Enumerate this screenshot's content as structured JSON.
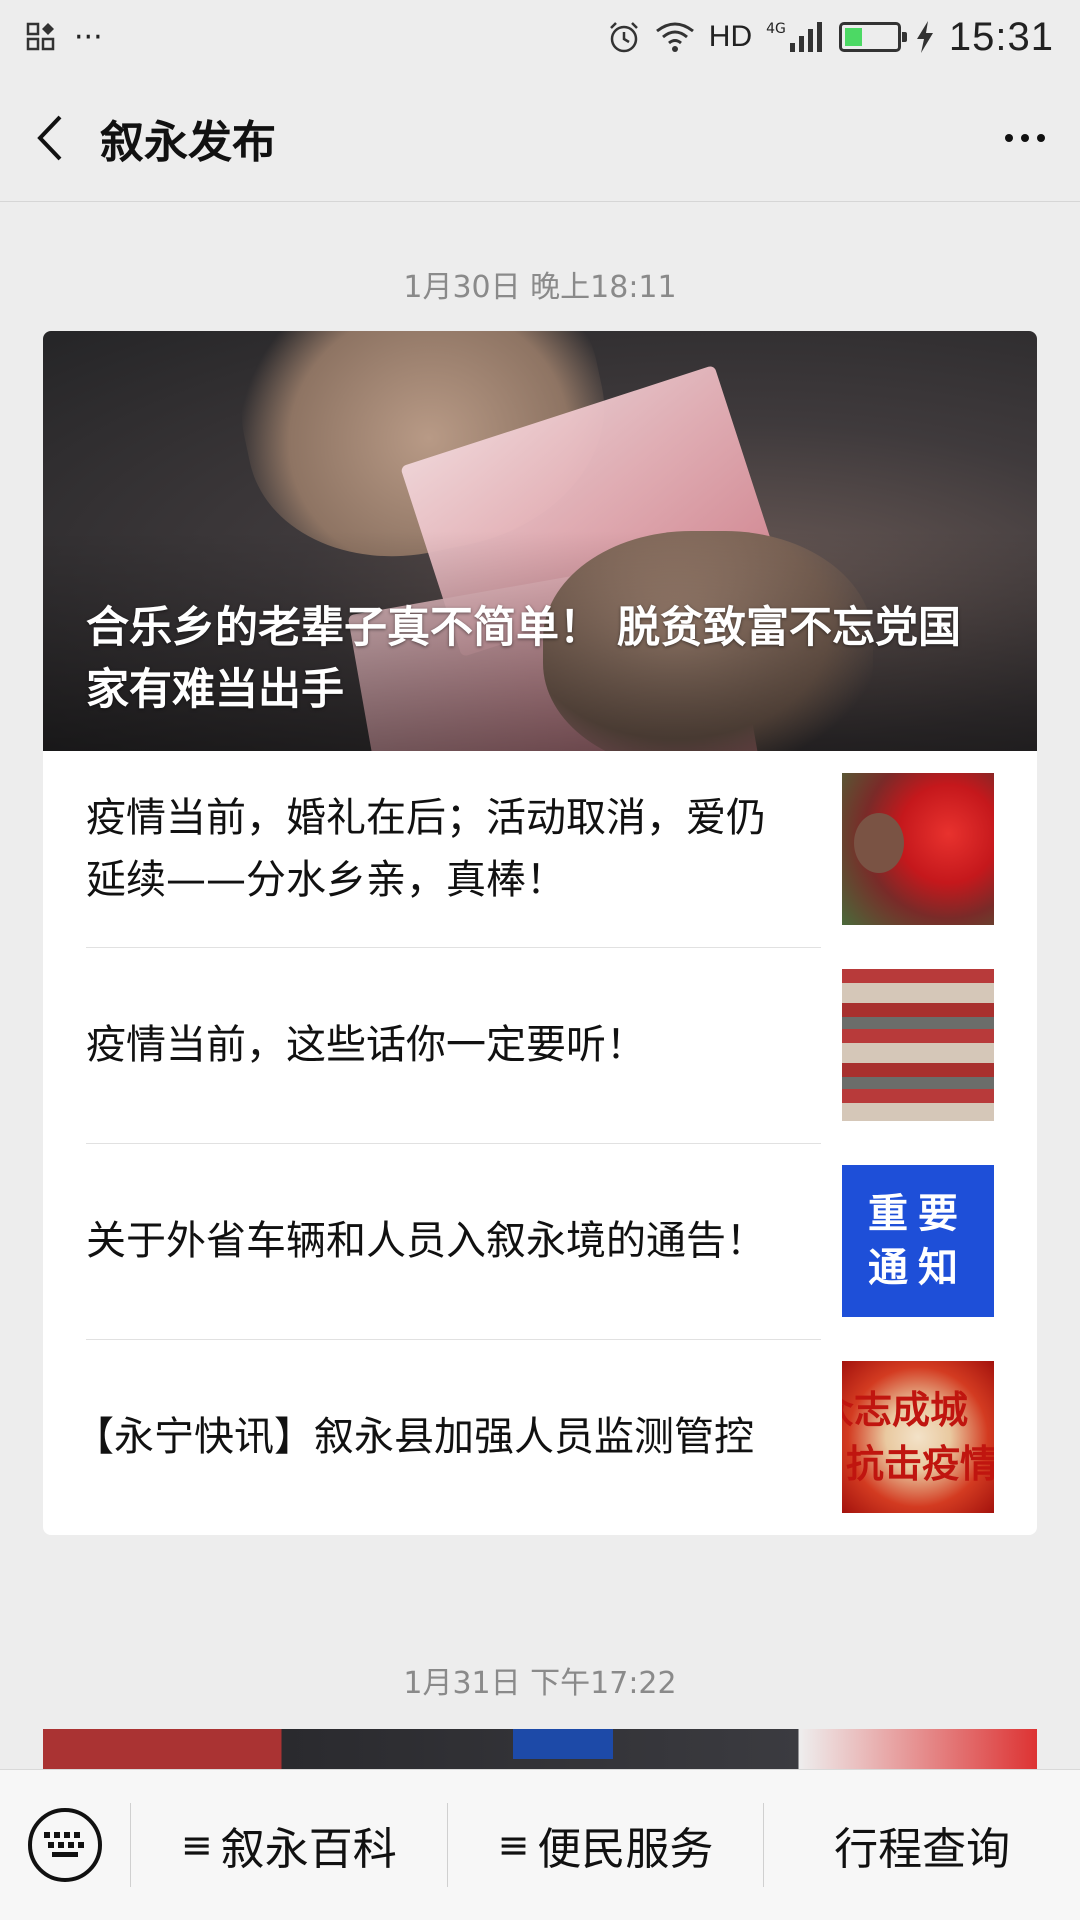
{
  "status_bar": {
    "left_icons": [
      "app-grid-icon",
      "more-dots-icon"
    ],
    "more_dots": "···",
    "hd": "HD",
    "network": "4G",
    "battery_level": 0.35,
    "time": "15:31"
  },
  "nav": {
    "title": "叙永发布"
  },
  "messages": [
    {
      "timestamp": "1月30日 晚上18:11",
      "hero_title": "合乐乡的老辈子真不简单！ 脱贫致富不忘党国家有难当出手",
      "articles": [
        {
          "title": "疫情当前，婚礼在后；活动取消，爱仍延续——分水乡亲，真棒！"
        },
        {
          "title": "疫情当前，这些话你一定要听！"
        },
        {
          "title": "关于外省车辆和人员入叙永境的通告！",
          "thumb_text_1": "重要",
          "thumb_text_2": "通知"
        },
        {
          "title": "【永宁快讯】叙永县加强人员监测管控",
          "thumb_text_1": "众志成城",
          "thumb_text_2": "抗击疫情"
        }
      ]
    },
    {
      "timestamp": "1月31日 下午17:22"
    }
  ],
  "bottom_menu": {
    "items": [
      {
        "label": "叙永百科",
        "icon": "≡"
      },
      {
        "label": "便民服务",
        "icon": "≡"
      },
      {
        "label": "行程查询"
      }
    ]
  },
  "colors": {
    "background": "#ededed",
    "notice_blue": "#1e4fd8"
  }
}
